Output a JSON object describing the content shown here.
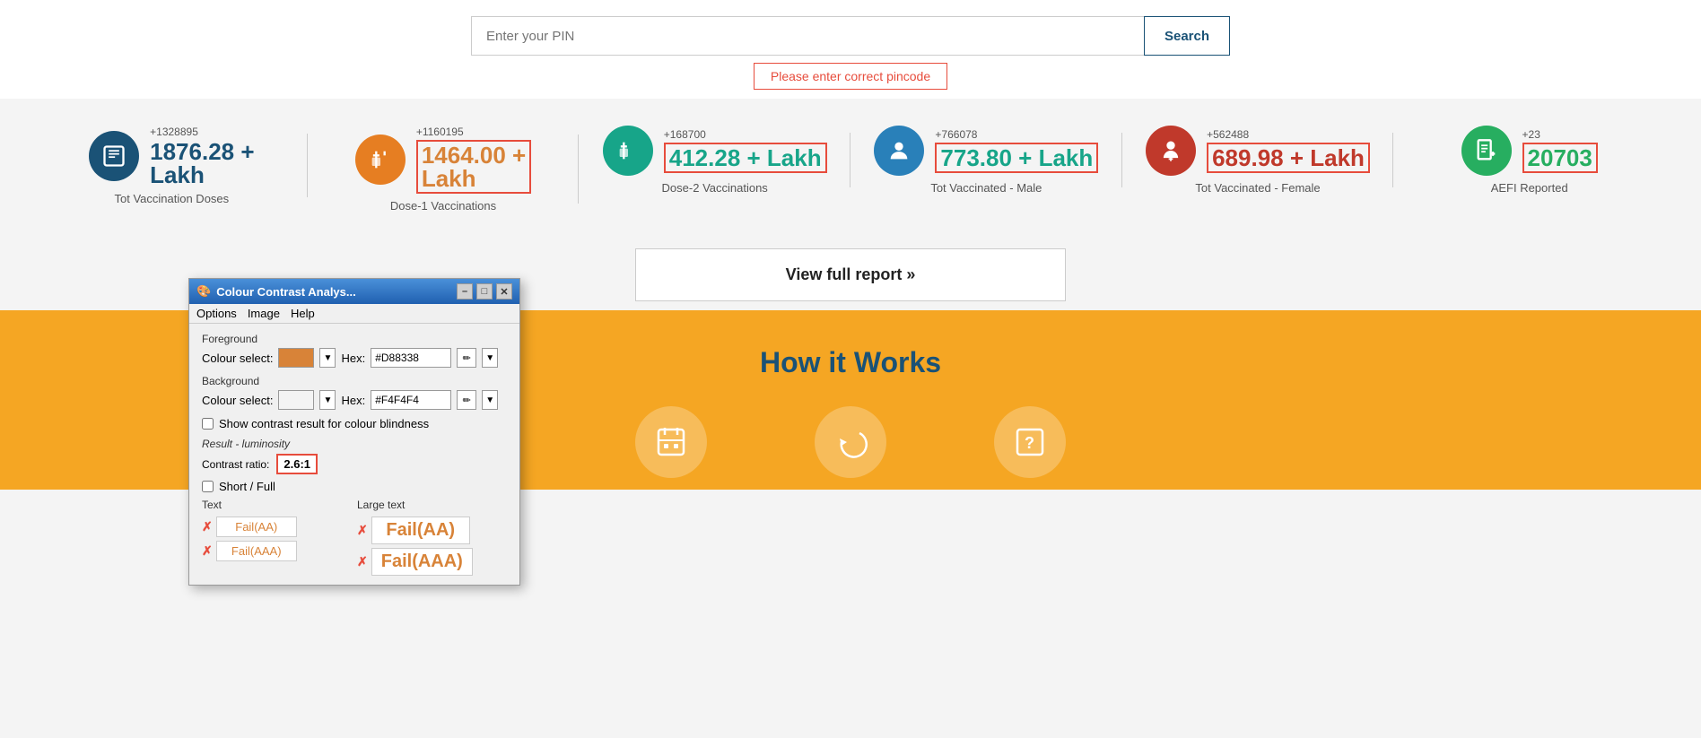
{
  "search": {
    "placeholder": "Enter your PIN",
    "button_label": "Search",
    "error_msg": "Please enter correct pincode"
  },
  "stats": [
    {
      "id": "tot-vaccination-doses",
      "increment": "+1328895",
      "value": "1876.28 +",
      "unit": "Lakh",
      "label": "Tot Vaccination Doses",
      "icon_type": "blue",
      "icon_symbol": "📋",
      "highlight": "none"
    },
    {
      "id": "dose-1",
      "increment": "+1160195",
      "value": "1464.00 +",
      "unit": "Lakh",
      "label": "Dose-1 Vaccinations",
      "icon_type": "orange",
      "icon_symbol": "💉",
      "highlight": "orange"
    },
    {
      "id": "dose-2",
      "increment": "+168700",
      "value": "412.28 + Lakh",
      "unit": "",
      "label": "Dose-2 Vaccinations",
      "icon_type": "teal",
      "icon_symbol": "💉",
      "highlight": "teal"
    },
    {
      "id": "tot-male",
      "increment": "+766078",
      "value": "773.80 + Lakh",
      "unit": "",
      "label": "Tot Vaccinated - Male",
      "icon_type": "cyan",
      "icon_symbol": "👤",
      "highlight": "teal"
    },
    {
      "id": "tot-female",
      "increment": "+562488",
      "value": "689.98 + Lakh",
      "unit": "",
      "label": "Tot Vaccinated - Female",
      "icon_type": "pink",
      "icon_symbol": "👤",
      "highlight": "pink"
    },
    {
      "id": "aefi",
      "increment": "+23",
      "value": "20703",
      "unit": "",
      "label": "AEFI Reported",
      "icon_type": "green",
      "icon_symbol": "📄",
      "highlight": "green"
    }
  ],
  "report_btn": "View full report »",
  "how_it_works_title": "How it Works",
  "dialog": {
    "title": "Colour Contrast Analys...",
    "menu": [
      "Options",
      "Image",
      "Help"
    ],
    "fg_label": "Foreground",
    "fg_colour_label": "Colour select:",
    "fg_hex": "#D88338",
    "bg_label": "Background",
    "bg_colour_label": "Colour select:",
    "bg_hex": "#F4F4F4",
    "checkbox_label": "Show contrast result for colour blindness",
    "result_luminosity": "Result - luminosity",
    "contrast_label": "Contrast ratio:",
    "contrast_value": "2.6:1",
    "short_full_label": "Short / Full",
    "text_label": "Text",
    "large_text_label": "Large text",
    "fail_aa": "Fail(AA)",
    "fail_aaa": "Fail(AAA)",
    "fail_aa_large": "Fail(AA)",
    "fail_aaa_large": "Fail(AAA)"
  }
}
